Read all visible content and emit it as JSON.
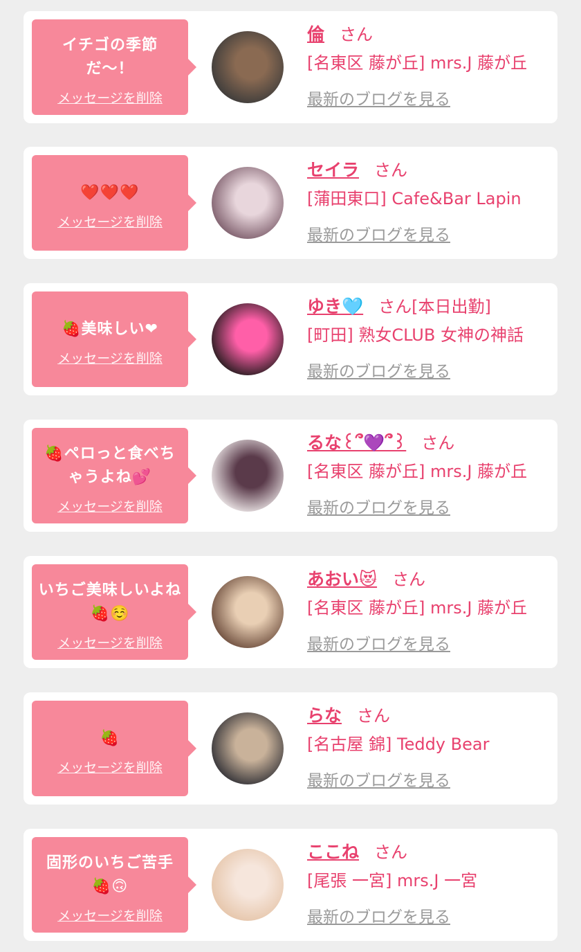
{
  "list": [
    {
      "message": "イチゴの季節だ〜！",
      "delete_label": "メッセージを削除",
      "name": "倫",
      "honorific": "さん",
      "shop": "[名東区 藤が丘] mrs.J 藤が丘",
      "blog_label": "最新のブログを見る",
      "avatar_colors": [
        "#3a3a3a",
        "#8a6a52"
      ]
    },
    {
      "message": "❤️❤️❤️",
      "delete_label": "メッセージを削除",
      "name": "セイラ",
      "honorific": "さん",
      "shop": "[蒲田東口] Cafe&Bar Lapin",
      "blog_label": "最新のブログを見る",
      "avatar_colors": [
        "#7a5a68",
        "#e8d6dc"
      ]
    },
    {
      "message": "🍓美味しい❤",
      "delete_label": "メッセージを削除",
      "name": "ゆき🩵",
      "honorific": "さん[本日出勤]",
      "shop": "[町田] 熟女CLUB 女神の神話",
      "blog_label": "最新のブログを見る",
      "avatar_colors": [
        "#1e1a1a",
        "#ff5fa8"
      ]
    },
    {
      "message": "🍓ペロっと食べちゃうよね💕",
      "delete_label": "メッセージを削除",
      "name": "るな꒰՞💜՞꒱",
      "honorific": "さん",
      "shop": "[名東区 藤が丘] mrs.J 藤が丘",
      "blog_label": "最新のブログを見る",
      "avatar_colors": [
        "#f1ecec",
        "#5a3a4a"
      ]
    },
    {
      "message": "いちご美味しいよね🍓☺️",
      "delete_label": "メッセージを削除",
      "name": "あおい😻",
      "honorific": "さん",
      "shop": "[名東区 藤が丘] mrs.J 藤が丘",
      "blog_label": "最新のブログを見る",
      "avatar_colors": [
        "#6a4a3a",
        "#e9cfb4"
      ]
    },
    {
      "message": "🍓",
      "delete_label": "メッセージを削除",
      "name": "らな",
      "honorific": "さん",
      "shop": "[名古屋 錦] Teddy Bear",
      "blog_label": "最新のブログを見る",
      "avatar_colors": [
        "#2e2e34",
        "#c9b29a"
      ]
    },
    {
      "message": "固形のいちご苦手🍓🙃",
      "delete_label": "メッセージを削除",
      "name": "ここね",
      "honorific": "さん",
      "shop": "[尾張 一宮] mrs.J 一宮",
      "blog_label": "最新のブログを見る",
      "avatar_colors": [
        "#e5c4a8",
        "#f6e6dc"
      ]
    }
  ]
}
